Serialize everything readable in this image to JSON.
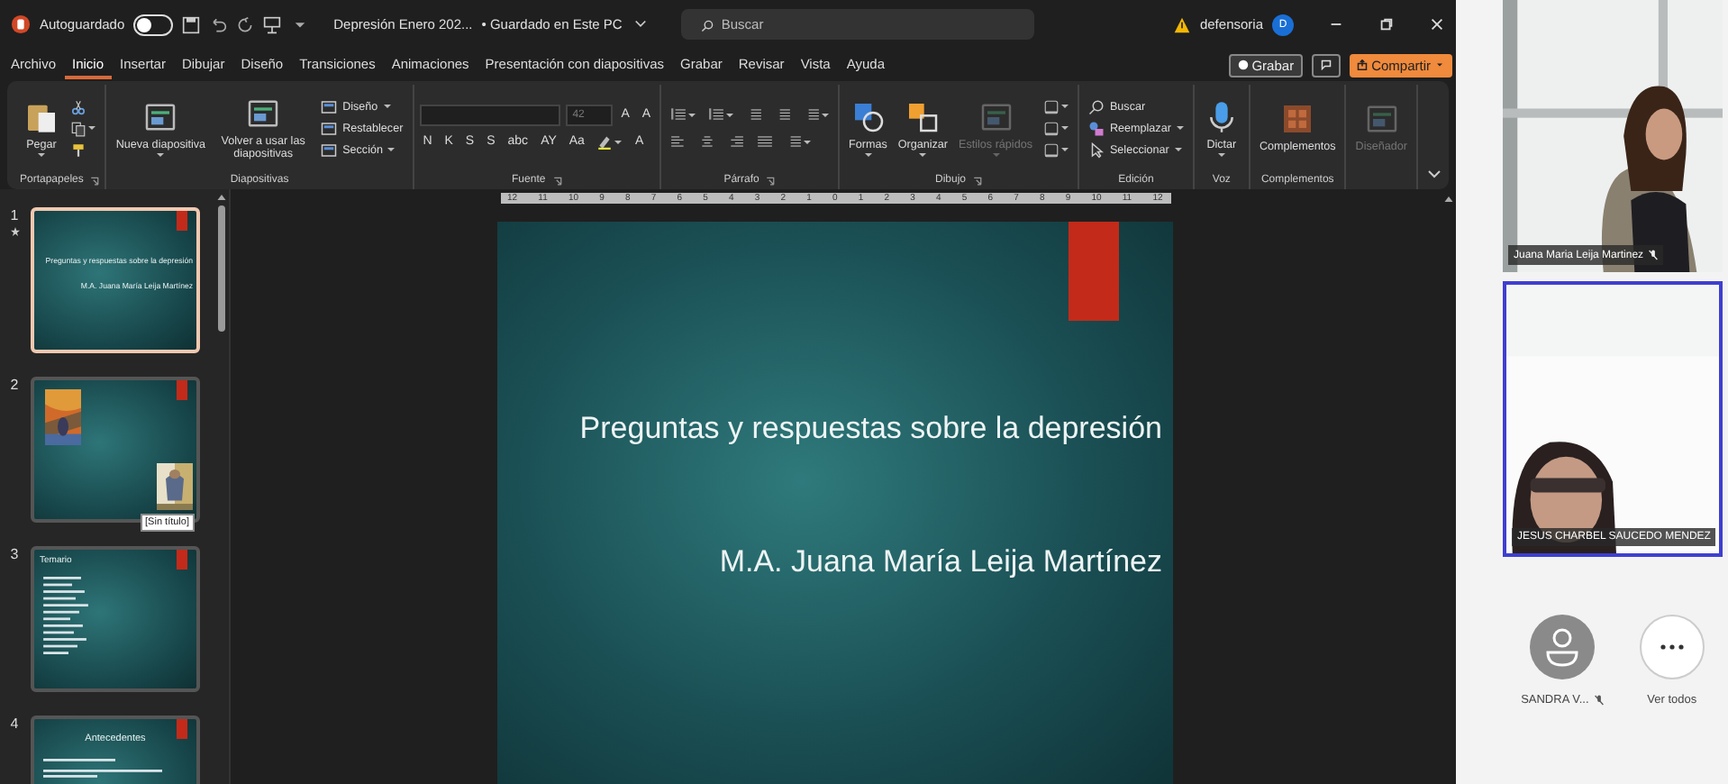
{
  "titlebar": {
    "autosave_label": "Autoguardado",
    "autosave_on": false,
    "document": "Depresión Enero 202...",
    "status": "• Guardado en Este PC",
    "search_placeholder": "Buscar",
    "user": "defensoria",
    "initial": "D"
  },
  "tabs": [
    {
      "label": "Archivo",
      "selected": false
    },
    {
      "label": "Inicio",
      "selected": true
    },
    {
      "label": "Insertar",
      "selected": false
    },
    {
      "label": "Dibujar",
      "selected": false
    },
    {
      "label": "Diseño",
      "selected": false
    },
    {
      "label": "Transiciones",
      "selected": false
    },
    {
      "label": "Animaciones",
      "selected": false
    },
    {
      "label": "Presentación con diapositivas",
      "selected": false
    },
    {
      "label": "Grabar",
      "selected": false
    },
    {
      "label": "Revisar",
      "selected": false
    },
    {
      "label": "Vista",
      "selected": false
    },
    {
      "label": "Ayuda",
      "selected": false
    }
  ],
  "actions": [
    {
      "kind": "record",
      "label": "Grabar"
    },
    {
      "kind": "comments"
    },
    {
      "kind": "share",
      "label": "Compartir"
    }
  ],
  "ribbon": [
    {
      "label": "Portapapeles",
      "launcher": true,
      "columns": [
        [
          {
            "kind": "large",
            "label": "Pegar",
            "menu": true,
            "disabled": false
          }
        ],
        [
          {
            "kind": "icon",
            "menu": false,
            "disabled": false
          },
          {
            "kind": "icon",
            "menu": true,
            "disabled": false
          },
          {
            "kind": "icon",
            "menu": false,
            "disabled": false
          }
        ]
      ]
    },
    {
      "label": "Diapositivas",
      "launcher": false,
      "columns": [
        [
          {
            "kind": "large",
            "label": "Nueva diapositiva",
            "menu": true,
            "disabled": false
          }
        ],
        [
          {
            "kind": "large",
            "label": "Volver a usar las diapositivas",
            "menu": false,
            "disabled": false
          }
        ],
        [
          {
            "kind": "small",
            "label": "Diseño",
            "menu": true,
            "disabled": false
          },
          {
            "kind": "small",
            "label": "Restablecer",
            "menu": false,
            "disabled": false
          },
          {
            "kind": "small",
            "label": "Sección",
            "menu": true,
            "disabled": false
          }
        ]
      ]
    },
    {
      "label": "Fuente",
      "launcher": true,
      "columns": [
        [
          {
            "kind": "row",
            "items": [
              {
                "kind": "field"
              },
              {
                "kind": "field",
                "value": "42"
              },
              {
                "kind": "glyph",
                "label": "A"
              },
              {
                "kind": "glyph",
                "label": "A"
              }
            ]
          },
          {
            "kind": "row",
            "items": [
              {
                "kind": "glyph",
                "label": "N"
              },
              {
                "kind": "glyph",
                "label": "K"
              },
              {
                "kind": "glyph",
                "label": "S"
              },
              {
                "kind": "glyph",
                "label": "S"
              },
              {
                "kind": "glyph",
                "label": "abc"
              },
              {
                "kind": "glyph",
                "label": "AY"
              },
              {
                "kind": "glyph",
                "label": "Aa"
              },
              {
                "kind": "icon",
                "menu": true,
                "disabled": false
              },
              {
                "kind": "glyph",
                "label": "A"
              }
            ]
          }
        ]
      ]
    },
    {
      "label": "Párrafo",
      "launcher": true,
      "columns": [
        [
          {
            "kind": "row",
            "items": [
              {
                "kind": "icon",
                "menu": true,
                "disabled": false
              },
              {
                "kind": "icon",
                "menu": true,
                "disabled": false
              },
              {
                "kind": "icon",
                "menu": false,
                "disabled": false
              },
              {
                "kind": "icon",
                "menu": false,
                "disabled": false
              },
              {
                "kind": "icon",
                "menu": true,
                "disabled": false
              }
            ]
          },
          {
            "kind": "row",
            "items": [
              {
                "kind": "icon",
                "menu": false,
                "disabled": false
              },
              {
                "kind": "icon",
                "menu": false,
                "disabled": false
              },
              {
                "kind": "icon",
                "menu": false,
                "disabled": false
              },
              {
                "kind": "icon",
                "menu": false,
                "disabled": false
              },
              {
                "kind": "icon",
                "menu": true,
                "disabled": false
              }
            ]
          }
        ]
      ]
    },
    {
      "label": "Dibujo",
      "launcher": true,
      "columns": [
        [
          {
            "kind": "large",
            "label": "Formas",
            "menu": true,
            "disabled": false
          }
        ],
        [
          {
            "kind": "large",
            "label": "Organizar",
            "menu": true,
            "disabled": false
          }
        ],
        [
          {
            "kind": "large",
            "label": "Estilos rápidos",
            "menu": true,
            "disabled": true
          }
        ],
        [
          {
            "kind": "icon",
            "menu": true,
            "disabled": false
          },
          {
            "kind": "icon",
            "menu": true,
            "disabled": false
          },
          {
            "kind": "icon",
            "menu": true,
            "disabled": false
          }
        ]
      ]
    },
    {
      "label": "Edición",
      "launcher": false,
      "columns": [
        [
          {
            "kind": "small",
            "label": "Buscar",
            "menu": false,
            "disabled": false
          },
          {
            "kind": "small",
            "label": "Reemplazar",
            "menu": true,
            "disabled": false
          },
          {
            "kind": "small",
            "label": "Seleccionar",
            "menu": true,
            "disabled": false
          }
        ]
      ]
    },
    {
      "label": "Voz",
      "launcher": false,
      "columns": [
        [
          {
            "kind": "large",
            "label": "Dictar",
            "menu": true,
            "disabled": false
          }
        ]
      ]
    },
    {
      "label": "Complementos",
      "launcher": false,
      "columns": [
        [
          {
            "kind": "large",
            "label": "Complementos",
            "menu": false,
            "disabled": false
          }
        ]
      ]
    },
    {
      "columns": [
        [
          {
            "kind": "large",
            "label": "Diseñador",
            "menu": false,
            "disabled": true
          }
        ]
      ]
    }
  ],
  "ruler": [
    "12",
    "11",
    "10",
    "9",
    "8",
    "7",
    "6",
    "5",
    "4",
    "3",
    "2",
    "1",
    "0",
    "1",
    "2",
    "3",
    "4",
    "5",
    "6",
    "7",
    "8",
    "9",
    "10",
    "11",
    "12"
  ],
  "slides": [
    {
      "number": "1",
      "selected": true,
      "starred": true,
      "kind": "title",
      "title": "Preguntas y respuestas sobre la depresión",
      "subtitle": "M.A. Juana María Leija Martínez"
    },
    {
      "number": "2",
      "selected": false,
      "starred": false,
      "kind": "pictures",
      "tooltip": "[Sin título]"
    },
    {
      "number": "3",
      "selected": false,
      "starred": false,
      "kind": "list",
      "title": "Temario"
    },
    {
      "number": "4",
      "selected": false,
      "starred": false,
      "kind": "centered",
      "title": "Antecedentes"
    }
  ],
  "slide": {
    "title": "Preguntas y respuestas sobre la depresión",
    "subtitle": "M.A. Juana María Leija Martínez"
  },
  "participants": [
    {
      "kind": "video",
      "name": "Juana Maria Leija Martinez",
      "muted": true,
      "selected": false
    },
    {
      "kind": "video",
      "name": "JESUS CHARBEL SAUCEDO MENDEZ",
      "muted": false,
      "selected": true
    },
    {
      "kind": "avatar",
      "name": "SANDRA V...",
      "muted": true
    }
  ],
  "more": {
    "label": "Ver todos"
  }
}
